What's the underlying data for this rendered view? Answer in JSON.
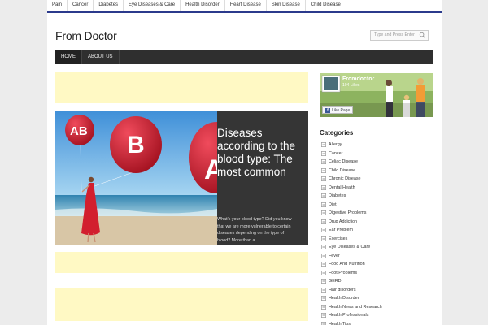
{
  "top_nav": [
    "Pain",
    "Cancer",
    "Diabetes",
    "Eye Diseases & Care",
    "Health Disorder",
    "Heart Disease",
    "Skin Disease",
    "Child Disease"
  ],
  "site": {
    "logo": "From Doctor"
  },
  "search": {
    "placeholder": "Type and Press Enter"
  },
  "main_nav": [
    {
      "label": "HOME",
      "active": true
    },
    {
      "label": "ABOUT US",
      "active": false
    }
  ],
  "hero": {
    "title": "Diseases according to the blood type: The most common",
    "excerpt": "What's your blood type? Did you know that we are more vulnerable to certain diseases depending on the type of blood? More than a",
    "balloon_labels": [
      "AB",
      "B",
      "A"
    ]
  },
  "facebook": {
    "page_name": "Fromdoctor",
    "likes": "104 Likes",
    "like_button": "Like Page"
  },
  "sidebar": {
    "categories_title": "Categories",
    "categories": [
      "Allergy",
      "Cancer",
      "Celiac Disease",
      "Child Disease",
      "Chronic Disease",
      "Dental Health",
      "Diabetes",
      "Diet",
      "Digestive Problems",
      "Drug Addiction",
      "Ear Problem",
      "Exercises",
      "Eye Diseases & Care",
      "Fever",
      "Food And Nutrition",
      "Foot Problems",
      "GERD",
      "Hair disorders",
      "Health Disorder",
      "Health News and Research",
      "Health Professionals",
      "Health Tips"
    ]
  },
  "colors": {
    "nav_accent": "#2b3a8c",
    "main_nav_bg": "#2f2f2f",
    "ad_bg": "#fff9c4"
  },
  "icons": {
    "search": "magnifier-icon",
    "category": "folder-icon",
    "facebook": "facebook-f-icon"
  }
}
